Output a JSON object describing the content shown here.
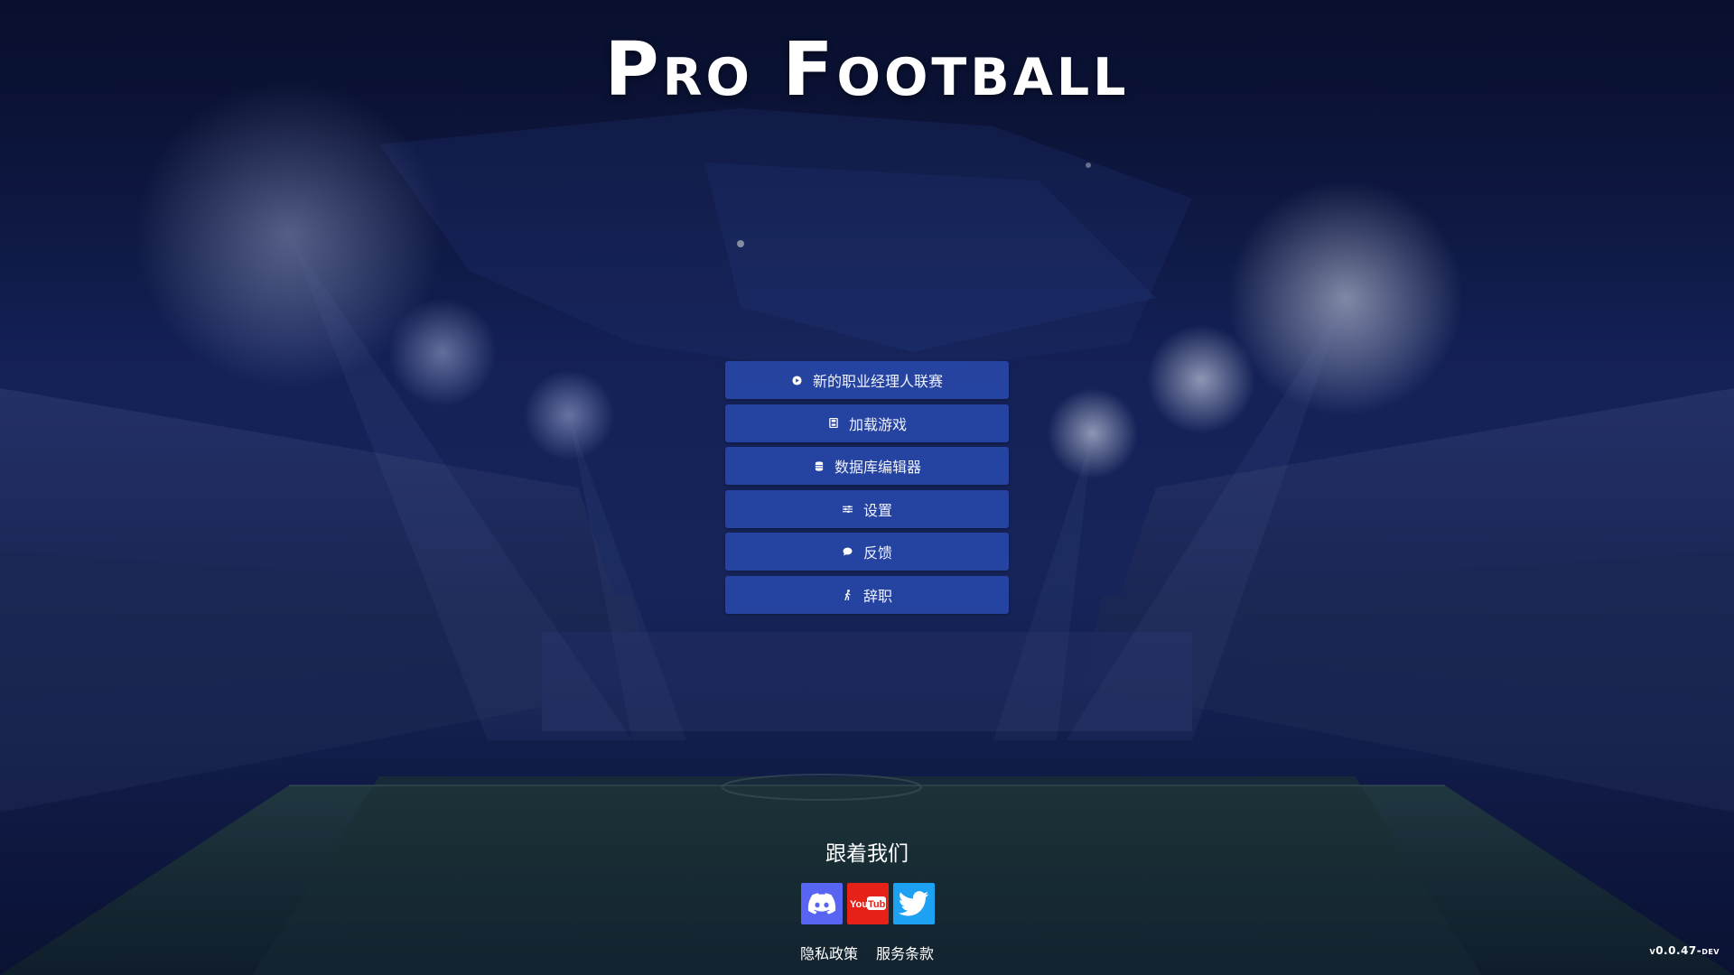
{
  "title": "Pro Football",
  "menu": [
    {
      "label": "新的职业经理人联赛",
      "icon": "play-circle-icon"
    },
    {
      "label": "加载游戏",
      "icon": "save-file-icon"
    },
    {
      "label": "数据库编辑器",
      "icon": "database-icon"
    },
    {
      "label": "设置",
      "icon": "sliders-icon"
    },
    {
      "label": "反馈",
      "icon": "chat-bubble-icon"
    },
    {
      "label": "辞职",
      "icon": "walking-person-icon"
    }
  ],
  "follow_title": "跟着我们",
  "socials": [
    {
      "name": "discord",
      "color": "#5865F2",
      "icon": "discord-icon"
    },
    {
      "name": "youtube",
      "color": "#E62117",
      "label": "YouTube",
      "icon": "youtube-icon"
    },
    {
      "name": "twitter",
      "color": "#1DA1F2",
      "icon": "twitter-bird-icon"
    }
  ],
  "links": {
    "privacy": "隐私政策",
    "terms": "服务条款"
  },
  "version": "v0.0.47-dev",
  "colors": {
    "button_bg": "#2848AA",
    "background": "#0A1233"
  }
}
